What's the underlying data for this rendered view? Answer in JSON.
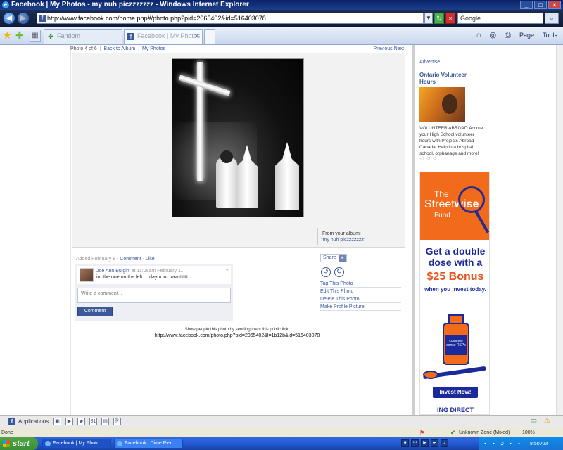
{
  "browser": {
    "window_title": "Facebook | My Photos - my nuh piczzzzzzz - Windows Internet Explorer",
    "address": "http://www.facebook.com/home.php#/photo.php?pid=2065402&id=516403078",
    "search_placeholder": "Google",
    "tabs": [
      {
        "label": "Fandom"
      },
      {
        "label": "Facebook | My Photos"
      }
    ],
    "commands": {
      "page": "Page",
      "tools": "Tools"
    },
    "status_text": "Done",
    "zone": "Unknown Zone (Mixed)",
    "zoom": "100%"
  },
  "photo": {
    "count": "Photo 4 of 6",
    "back_link": "Back to Album",
    "my_photos_link": "My Photos",
    "previous": "Previous",
    "next": "Next",
    "album_label": "From your album:",
    "album_name": "\"my nuh piczzzzzzz\"",
    "added": "Added February 8",
    "comment_link": "Comment",
    "like_link": "Like",
    "share_label": "Share",
    "actions": [
      "Tag This Photo",
      "Edit This Photo",
      "Delete This Photo",
      "Make Profile Picture"
    ],
    "share_note": "Show people this photo by sending them this public link:",
    "share_url": "http://www.facebook.com/photo.php?pid=2065402&l=1b12b&id=516403078"
  },
  "comment": {
    "author": "Joe Ann Bulgin",
    "time": "at 11:08am February 11",
    "text": "im the one on the left.... daym im hawttttttt",
    "input_placeholder": "Write a comment...",
    "submit_label": "Comment"
  },
  "sidebar": {
    "advertise": "Advertise",
    "ad_title": "Ontario Volunteer Hours",
    "ad_body": "VOLUNTEER ABROAD Accrue your High School volunteer hours with Projects Abroad Canada. Help in a hospital, school, orphanage and more!",
    "banner": {
      "line1": "The",
      "line2a": "Street",
      "line2b": "wise",
      "line3": "Fund",
      "headline": "Get a double dose with a",
      "bonus": "$25 Bonus",
      "sub": "when you invest today.",
      "bottle_label": "common sense RSPs",
      "invest": "Invest Now!",
      "ing": "ING DIRECT"
    }
  },
  "fbbar": {
    "applications": "Applications"
  },
  "taskbar": {
    "start": "start",
    "tasks": [
      "Facebook | My Photo...",
      "Facebook | Dime Piec..."
    ],
    "clock": "8:50 AM"
  }
}
